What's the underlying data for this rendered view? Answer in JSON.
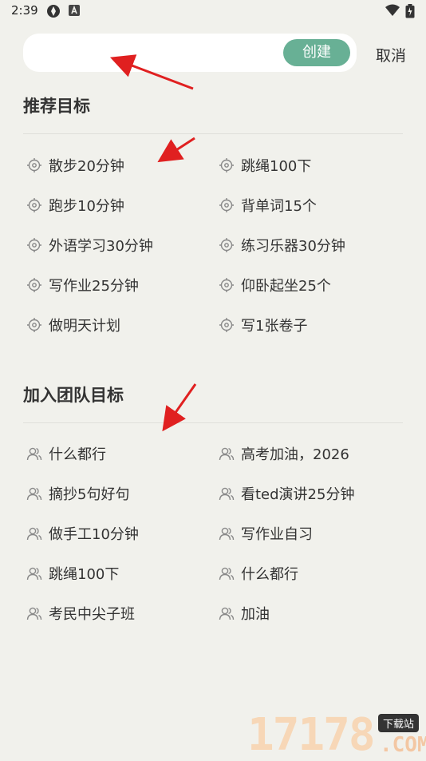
{
  "status_bar": {
    "time": "2:39"
  },
  "search": {
    "placeholder": "",
    "value": "",
    "create_label": "创建",
    "cancel_label": "取消"
  },
  "recommended": {
    "title": "推荐目标",
    "items": [
      "散步20分钟",
      "跳绳100下",
      "跑步10分钟",
      "背单词15个",
      "外语学习30分钟",
      "练习乐器30分钟",
      "写作业25分钟",
      "仰卧起坐25个",
      "做明天计划",
      "写1张卷子"
    ]
  },
  "team": {
    "title": "加入团队目标",
    "items": [
      "什么都行",
      "高考加油，2026",
      "摘抄5句好句",
      "看ted演讲25分钟",
      "做手工10分钟",
      "写作业自习",
      "跳绳100下",
      "什么都行",
      "考民中尖子班",
      "加油"
    ]
  },
  "watermark": {
    "digits": "17178",
    "badge": "下载站",
    "suffix": ".COM"
  },
  "colors": {
    "accent": "#68b095",
    "background": "#f1f1ec",
    "arrow": "#e02020"
  },
  "icons": {
    "recommended_item": "target-icon",
    "team_item": "group-icon"
  }
}
